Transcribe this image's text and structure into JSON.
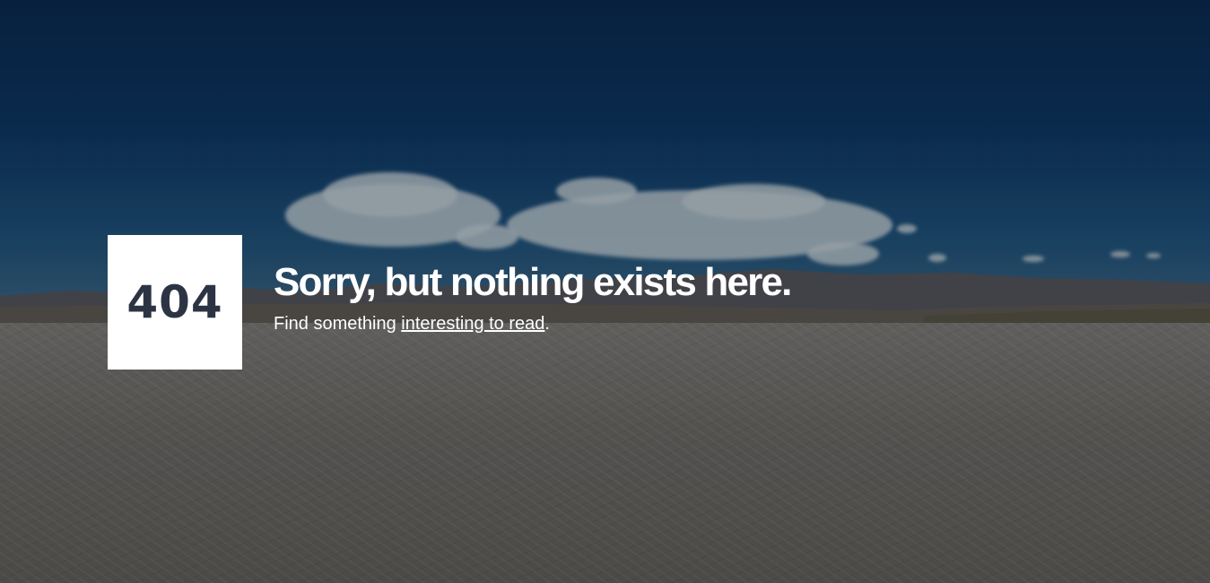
{
  "error": {
    "code": "404",
    "headline": "Sorry, but nothing exists here.",
    "subline_prefix": "Find something ",
    "link_text": "interesting to read",
    "subline_suffix": "."
  },
  "colors": {
    "code_box_bg": "#ffffff",
    "code_text": "#2c3444",
    "headline_text": "#ffffff"
  }
}
